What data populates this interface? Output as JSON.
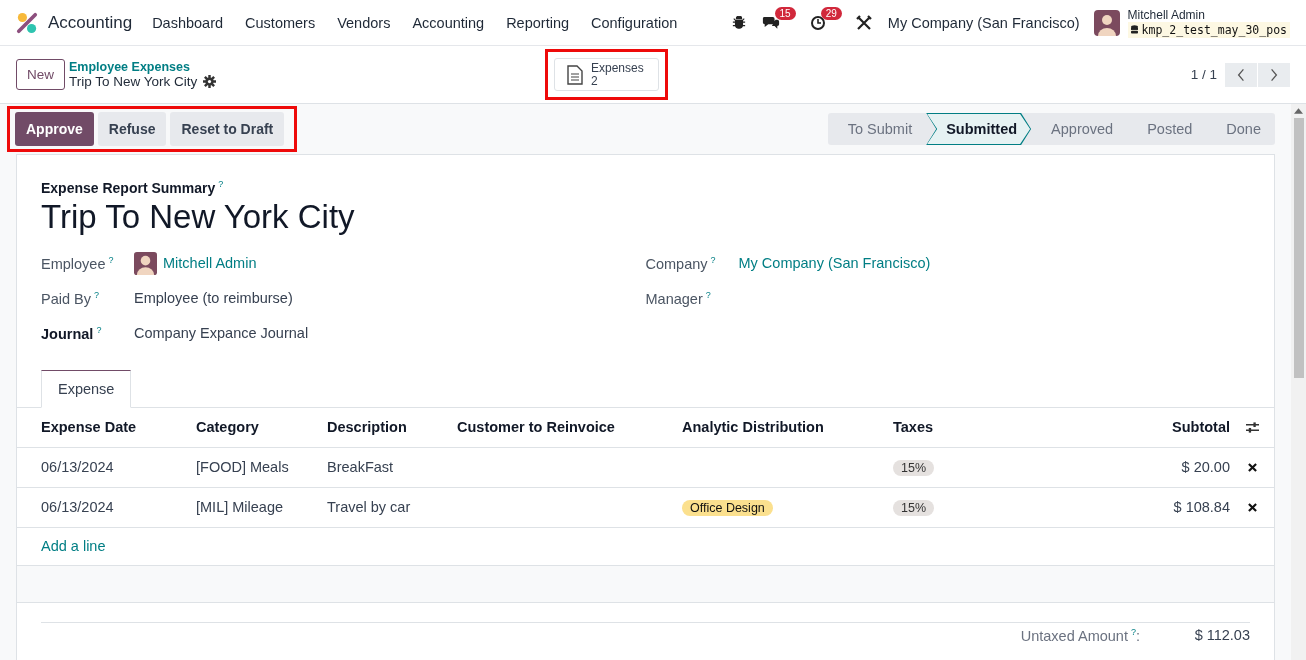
{
  "app": {
    "name": "Accounting"
  },
  "menu": [
    "Dashboard",
    "Customers",
    "Vendors",
    "Accounting",
    "Reporting",
    "Configuration"
  ],
  "systray": {
    "messages_count": "15",
    "activities_count": "29",
    "company": "My Company (San Francisco)",
    "user": "Mitchell Admin",
    "database": "kmp_2_test_may_30_pos"
  },
  "control_panel": {
    "new_button": "New",
    "breadcrumb": "Employee Expenses",
    "record": "Trip To New York City",
    "stat_button": {
      "label": "Expenses",
      "count": "2",
      "highlighted": true
    },
    "pager": "1 / 1"
  },
  "actions": {
    "highlighted": true,
    "buttons": [
      {
        "label": "Approve",
        "kind": "primary"
      },
      {
        "label": "Refuse",
        "kind": "secondary"
      },
      {
        "label": "Reset to Draft",
        "kind": "secondary"
      }
    ]
  },
  "stages": [
    {
      "label": "To Submit",
      "selected": false
    },
    {
      "label": "Submitted",
      "selected": true
    },
    {
      "label": "Approved",
      "selected": false
    },
    {
      "label": "Posted",
      "selected": false
    },
    {
      "label": "Done",
      "selected": false
    }
  ],
  "form": {
    "summary_label": "Expense Report Summary",
    "summary_help": "?",
    "title": "Trip To New York City",
    "left_fields": [
      {
        "label": "Employee",
        "help": "?",
        "value": "Mitchell Admin",
        "kind": "user",
        "required": false
      },
      {
        "label": "Paid By",
        "help": "?",
        "value": "Employee (to reimburse)",
        "kind": "text",
        "required": false
      },
      {
        "label": "Journal",
        "help": "?",
        "value": "Company Expance Journal",
        "kind": "text",
        "required": true
      }
    ],
    "right_fields": [
      {
        "label": "Company",
        "help": "?",
        "value": "My Company (San Francisco)",
        "kind": "link",
        "required": false
      },
      {
        "label": "Manager",
        "help": "?",
        "kind": "empty",
        "required": false
      }
    ]
  },
  "tabs": [
    {
      "label": "Expense",
      "selected": true
    }
  ],
  "table": {
    "columns": [
      "Expense Date",
      "Category",
      "Description",
      "Customer to Reinvoice",
      "Analytic Distribution",
      "Taxes",
      "Subtotal"
    ],
    "rows": [
      {
        "date": "06/13/2024",
        "category": "[FOOD] Meals",
        "description": "BreakFast",
        "tax": "15%",
        "subtotal": "$ 20.00"
      },
      {
        "date": "06/13/2024",
        "category": "[MIL] Mileage",
        "description": "Travel by car",
        "analytic": "Office Design",
        "tax": "15%",
        "subtotal": "$ 108.84"
      }
    ],
    "add_line": "Add a line"
  },
  "totals": [
    {
      "label": "Untaxed Amount",
      "help": "?",
      "separator": ":",
      "value": "$ 112.03"
    }
  ]
}
